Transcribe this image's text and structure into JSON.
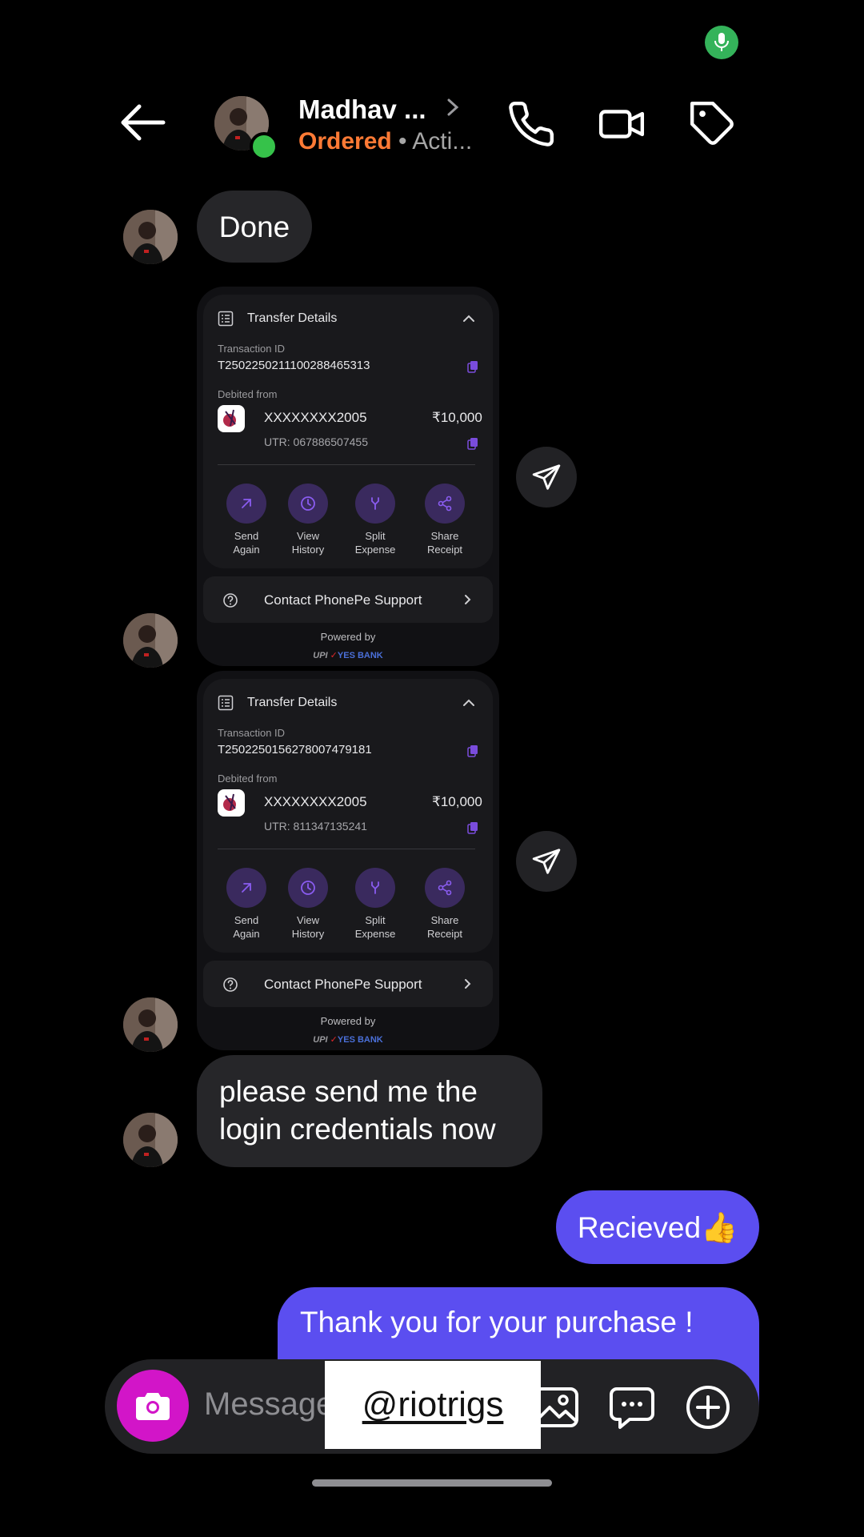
{
  "header": {
    "name": "Madhav ...",
    "status": "Ordered",
    "activity": " • Acti..."
  },
  "messages": {
    "done": "Done",
    "login_request": "please send me the login credentials now",
    "received": "Recieved👍",
    "thanks": "Thank you for your purchase !"
  },
  "cards": [
    {
      "title": "Transfer Details",
      "txn_label": "Transaction ID",
      "txn_id": "T2502250211100288465313",
      "debited_label": "Debited from",
      "account": "XXXXXXXX2005",
      "amount": "₹10,000",
      "utr": "UTR: 067886507455",
      "actions": [
        {
          "label": "Send Again",
          "icon": "arrow-up-right-icon"
        },
        {
          "label": "View History",
          "icon": "clock-icon"
        },
        {
          "label": "Split Expense",
          "icon": "fork-icon"
        },
        {
          "label": "Share Receipt",
          "icon": "share-icon"
        }
      ],
      "support": "Contact PhonePe Support",
      "powered": "Powered by",
      "upi": "UPI",
      "bank": "YES BANK"
    },
    {
      "title": "Transfer Details",
      "txn_label": "Transaction ID",
      "txn_id": "T2502250156278007479181",
      "debited_label": "Debited from",
      "account": "XXXXXXXX2005",
      "amount": "₹10,000",
      "utr": "UTR: 811347135241",
      "actions": [
        {
          "label": "Send Again",
          "icon": "arrow-up-right-icon"
        },
        {
          "label": "View History",
          "icon": "clock-icon"
        },
        {
          "label": "Split Expense",
          "icon": "fork-icon"
        },
        {
          "label": "Share Receipt",
          "icon": "share-icon"
        }
      ],
      "support": "Contact PhonePe Support",
      "powered": "Powered by",
      "upi": "UPI",
      "bank": "YES BANK"
    }
  ],
  "composer": {
    "placeholder": "Message",
    "watermark": "@riotrigs"
  },
  "colors": {
    "outgoing_bubble": "#5b4ef0",
    "incoming_bubble": "#262629",
    "status_orange": "#ff7a35",
    "camera_button": "#d215c8",
    "online_dot": "#36c24a",
    "mic_indicator": "#34b35a",
    "action_purple": "#8a5cf0"
  }
}
